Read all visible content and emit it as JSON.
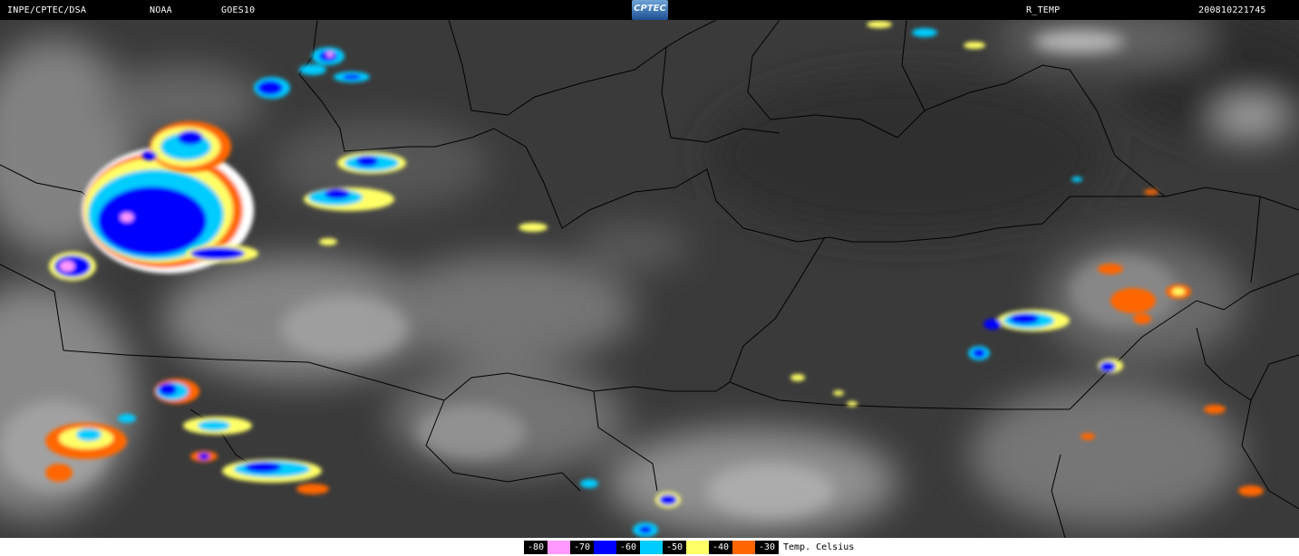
{
  "header": {
    "source": "INPE/CPTEC/DSA",
    "agency": "NOAA",
    "satellite": "GOES10",
    "logo_text": "CPTEC",
    "product": "R_TEMP",
    "timestamp": "200810221745"
  },
  "legend": {
    "items": [
      {
        "label": "-80",
        "color": "#ff99ff"
      },
      {
        "label": "-70",
        "color": "#0000ff"
      },
      {
        "label": "-60",
        "color": "#00ccff"
      },
      {
        "label": "-50",
        "color": "#ffff66"
      },
      {
        "label": "-40",
        "color": "#ff6600"
      },
      {
        "label": "-30",
        "color": "#ffffff"
      }
    ],
    "unit_label": "Temp. Celsius"
  },
  "colors": {
    "background": "#3a3a3a",
    "borders": "#000000",
    "cold_tops": [
      "#ff99ff",
      "#0000ff",
      "#00ccff",
      "#ffff66",
      "#ff6600"
    ]
  }
}
